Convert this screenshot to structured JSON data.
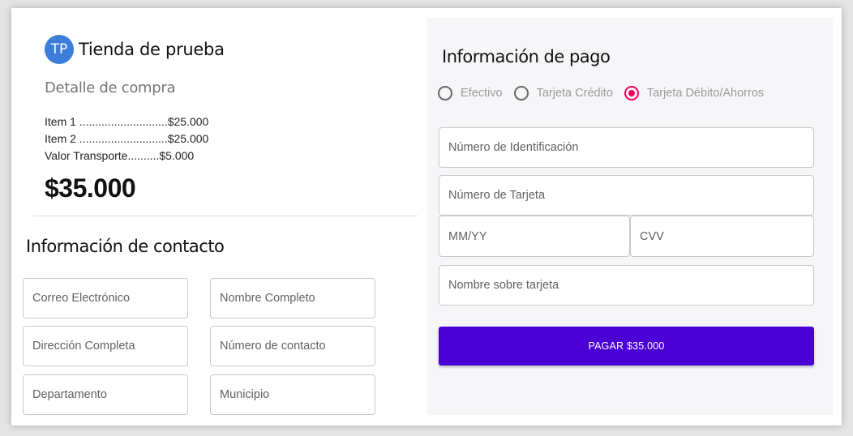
{
  "store": {
    "initials": "TP",
    "name": "Tienda de prueba"
  },
  "purchase": {
    "title": "Detalle de compra",
    "lines": [
      "Item 1 ............................$25.000",
      "Item 2 ............................$25.000",
      "Valor Transporte..........$5.000"
    ],
    "total": "$35.000"
  },
  "contact": {
    "title": "Información de contacto",
    "fields": {
      "email": "Correo Electrónico",
      "full_name": "Nombre Completo",
      "address": "Dirección Completa",
      "phone": "Número de contacto",
      "department": "Departamento",
      "municipality": "Municipio"
    }
  },
  "payment": {
    "title": "Información de pago",
    "methods": [
      {
        "label": "Efectivo",
        "selected": false
      },
      {
        "label": "Tarjeta Crédito",
        "selected": false
      },
      {
        "label": "Tarjeta Débito/Ahorros",
        "selected": true
      }
    ],
    "fields": {
      "id_number": "Número de Identificación",
      "card_number": "Número de Tarjeta",
      "expiry": "MM/YY",
      "cvv": "CVV",
      "card_name": "Nombre sobre tarjeta"
    },
    "button_label": "PAGAR $35.000"
  },
  "colors": {
    "accent": "#4a00d4",
    "avatar": "#3b7dd8",
    "radio_selected": "#f50057",
    "panel_bg": "#f6f6f8"
  }
}
